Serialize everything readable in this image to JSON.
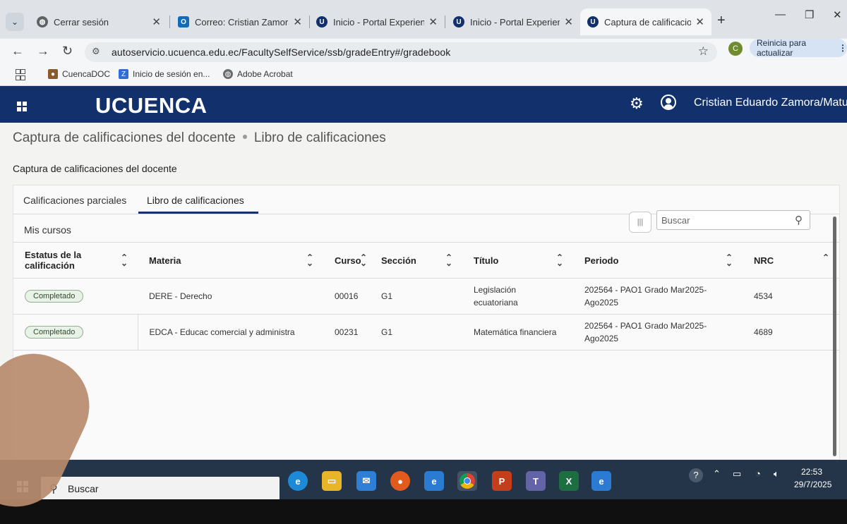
{
  "browser": {
    "tabs": [
      {
        "title": "Cerrar sesión",
        "active": false,
        "favicon": "globe-icon"
      },
      {
        "title": "Correo: Cristian Zamora",
        "active": false,
        "favicon": "outlook-icon"
      },
      {
        "title": "Inicio - Portal Experience",
        "active": false,
        "favicon": "u-icon"
      },
      {
        "title": "Inicio - Portal Experience",
        "active": false,
        "favicon": "u-icon"
      },
      {
        "title": "Captura de calificaciones",
        "active": true,
        "favicon": "u-icon"
      }
    ],
    "new_tab": "+",
    "window_controls": {
      "minimize": "—",
      "restore": "❐",
      "close": "✕"
    },
    "url": "autoservicio.ucuenca.edu.ec/FacultySelfService/ssb/gradeEntry#/gradebook",
    "profile_initial": "C",
    "update_button": "Reinicia para actualizar",
    "bookmarks": [
      {
        "label": "CuencaDOC",
        "icon": "cuencadoc-icon"
      },
      {
        "label": "Inicio de sesión en...",
        "icon": "zoho-icon"
      },
      {
        "label": "Adobe Acrobat",
        "icon": "globe-icon"
      }
    ]
  },
  "app": {
    "logo": "UCUENCA",
    "user_name": "Cristian Eduardo Zamora/Matute"
  },
  "breadcrumb": {
    "first": "Captura de calificaciones del docente",
    "second": "Libro de calificaciones"
  },
  "page_title": "Captura de calificaciones del docente",
  "tabs": {
    "partial": "Calificaciones parciales",
    "gradebook": "Libro de calificaciones"
  },
  "section_title": "Mis cursos",
  "search_placeholder": "Buscar",
  "table": {
    "columns": [
      "Estatus de la calificación",
      "Materia",
      "Curso",
      "Sección",
      "Título",
      "Periodo",
      "NRC"
    ],
    "rows": [
      {
        "status": "Completado",
        "materia": "DERE - Derecho",
        "curso": "00016",
        "seccion": "G1",
        "titulo": "Legislación ecuatoriana",
        "periodo": "202564 - PAO1 Grado Mar2025-Ago2025",
        "nrc": "4534"
      },
      {
        "status": "Completado",
        "materia": "EDCA - Educac comercial y administra",
        "curso": "00231",
        "seccion": "G1",
        "titulo": "Matemática financiera",
        "periodo": "202564 - PAO1 Grado Mar2025-Ago2025",
        "nrc": "4689"
      }
    ]
  },
  "taskbar": {
    "search_label": "Buscar",
    "apps": [
      "edge-icon",
      "file-explorer-icon",
      "mail-icon",
      "firefox-icon",
      "ie-icon",
      "chrome-icon",
      "powerpoint-icon",
      "teams-icon",
      "excel-icon",
      "ie-icon"
    ],
    "time": "22:53",
    "date": "29/7/2025"
  },
  "colors": {
    "header": "#12316c",
    "badge_bg": "#e8f2e6",
    "badge_border": "#8fb08f",
    "taskbar": "#243449"
  }
}
